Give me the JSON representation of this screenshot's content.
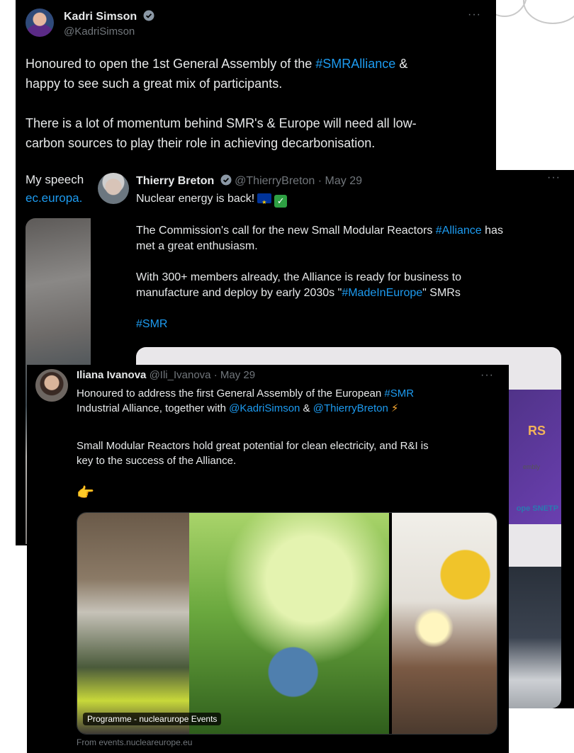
{
  "tweet1": {
    "author": "Kadri Simson",
    "handle": "@KadriSimson",
    "text_before": "Honoured to open the 1st General Assembly of the ",
    "hashtag": "#SMRAlliance",
    "text_after": " &\nhappy to see such a great mix of participants.\n\nThere is a lot of momentum behind SMR's & Europe will need all low-\ncarbon sources to play their role in achieving decarbonisation.",
    "speech_prefix": "My speech",
    "link_prefix": "ec.europa."
  },
  "tweet2": {
    "author": "Thierry Breton",
    "handle": "@ThierryBreton",
    "date": "· May 29",
    "line1": "Nuclear energy is back!",
    "para2_before": "The Commission's call for the new Small Modular Reactors ",
    "para2_tag": "#Alliance",
    "para2_after": " has\nmet a great enthusiasm.",
    "para3_before": "With 300+ members already, the Alliance is ready for business to\nmanufacture and deploy by early 2030s \"",
    "para3_tag": "#MadeInEurope",
    "para3_after": "\" SMRs",
    "tag_line": "#SMR",
    "slide_text": "RS",
    "slide_sub1": "embly",
    "slide_sub2": "4",
    "logo_text": "ope SNETP"
  },
  "tweet3": {
    "author": "Iliana Ivanova",
    "handle": "@Ili_Ivanova",
    "date": "· May 29",
    "l1_before": "Honoured to address the first General Assembly of the European ",
    "l1_tag": "#SMR",
    "l2_before": "\nIndustrial Alliance, together with ",
    "mention1": "@KadriSimson",
    "and": " & ",
    "mention2": "@ThierryBreton",
    "para2": "Small Modular Reactors hold great potential for clean electricity, and R&I is\nkey to the success of the Alliance.",
    "hand": "👉",
    "caption": "Programme - nuclearurope Events",
    "source": "From events.nucleareurope.eu"
  },
  "colors": {
    "background": "#000000",
    "text": "#e7e9ea",
    "link": "#1d9bf0",
    "muted": "#71767b",
    "verified": "#1d9bf0"
  },
  "icons": {
    "verified": "verified-badge-icon",
    "more": "more-options-icon",
    "flag": "eu-flag-emoji",
    "check": "check-mark-emoji",
    "bolt": "lightning-emoji",
    "hand": "pointing-hand-emoji"
  }
}
